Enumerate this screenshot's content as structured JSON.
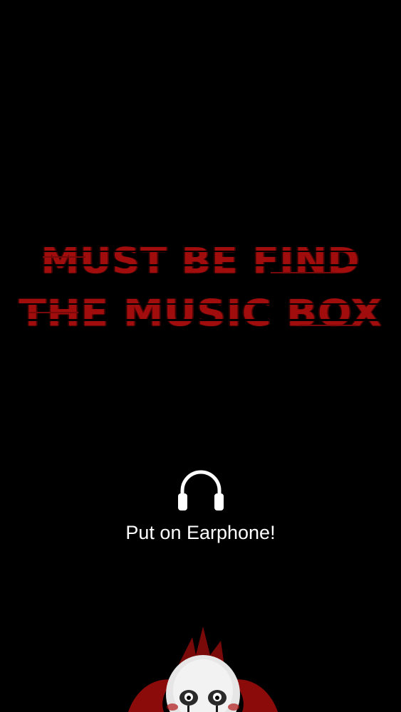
{
  "title": {
    "line1": "MUST BE FIND",
    "line2": "THE MUSIC BOX"
  },
  "prompt": {
    "icon": "headphones-icon",
    "text": "Put on Earphone!"
  },
  "mascot": {
    "icon": "clown-face-icon"
  },
  "colors": {
    "background": "#000000",
    "title": "#a10d0d",
    "prompt_text": "#ffffff",
    "icon": "#ffffff"
  }
}
